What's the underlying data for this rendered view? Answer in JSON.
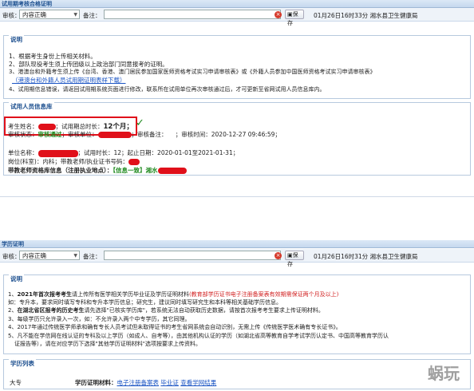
{
  "top_panel": {
    "title": "试用期考核合格证明",
    "toolbar": {
      "review_label": "审核：",
      "review_value": "内容正确",
      "remark_label": "备注：",
      "save_label": "保存",
      "reviewer_text": "01月26日16时33分 湘水县卫生健康局"
    },
    "notes": {
      "title": "说明",
      "lines": [
        "1、根据考生身份上传相关材料。",
        "2、部队现役考生须上传团级以上政治部门同意报考的证明。",
        "3、港澳台和外籍考生须上传《台湾、香港、澳门居民参加国家医师资格考试实习申请审核表》或《外籍人员参加中国医师资格考试实习申请审核表》",
        "（港澳台和外籍人员试用期证明表样下载）",
        "4、试用期信息错误，请返回试用期系统页面进行修改，联系所在试用单位再次审核通过后，才可更新至省网试用人员信息库内。"
      ]
    },
    "trial_info": {
      "title": "试用人员信息库",
      "r1_name_label": "考生姓名：",
      "r1_period_label": "；试用期总时长：",
      "r1_period_value": "12个月；",
      "r1_check": "✓",
      "r2_status_label": "审核状态：",
      "r2_status_value": "审核通过",
      "r2_unit_label": "；审核单位：",
      "r2_remark_label": "；审核备注：",
      "r2_remark_value": "；",
      "r2_time_label": "审核时间：",
      "r2_time_value": "2020-12-27 09:46:59；",
      "r3_unit_label": "单位名称：",
      "r3_duration_label": "；试用时长：",
      "r3_duration_value": "12",
      "r3_dates_label": "；起止日期：",
      "r3_dates_value": "2020-01-01至2021-01-31；",
      "r4_text": "岗位(科室)：",
      "r4_mid": "内科；带教老师/执业证书号码：",
      "r5_label": "带教老师资格库信息（注册执业地点）：",
      "r5_value": "【信息一致】湘水"
    }
  },
  "bottom_panel": {
    "title": "学历证明",
    "toolbar": {
      "review_label": "审核：",
      "review_value": "内容正确",
      "remark_label": "备注：",
      "save_label": "保存",
      "reviewer_text": "01月26日16时31分 湘水县卫生健康局"
    },
    "notes": {
      "title": "说明",
      "l1_prefix": "1、",
      "l1_bold": "2021年首次报考考生",
      "l1_text": "请上传所有医学相关学历毕业证及学历证明材料",
      "l1_red": "(教育部学历证书电子注册备案表有效期需保证两个月及以上)",
      "l1b": "如：专升本，要求同时填写专科和专升本学历信息；研究生，建议同时填写研究生和本科等相关基础学历信息。",
      "l2_prefix": "2、",
      "l2_bold": "在湖北省区报考的历史考生",
      "l2_text": "请先选择\"已核实学历库\"，若系统无法自动获取历史数据，请按首次报考考生要求上传证明材料。",
      "l3": "3、每级学历只允许录入一次，如：不允许录入两个中专学历，其它同理。",
      "l4": "4、2017年通过传统医学师承和确有专长人员考试但未取得证书的考生省网系统会自动识别，无需上传《传统医学医术确有专长证书》。",
      "l5": "5、凡不能在学信网在线认证的专科及以上学历（如成人、自考等），由其他机构认证的学历（如湖北省高等教育自学考试学历认定书、中国高等教育学历认",
      "l5b": "证报告等），请在对应学历下选择\"其他学历证明材料\"选项按要求上传资料。"
    },
    "edu_list": {
      "title": "学历列表",
      "degree": "大专",
      "materials_label": "学历证明材料：",
      "link1": "电子注册备案表",
      "link2": "毕业证",
      "link3": "查看学网结果"
    }
  },
  "watermark": "蜗玩",
  "colors": {
    "accent": "#1c4f8f",
    "warning": "#d11f1f",
    "ok": "#1f8a1f"
  }
}
